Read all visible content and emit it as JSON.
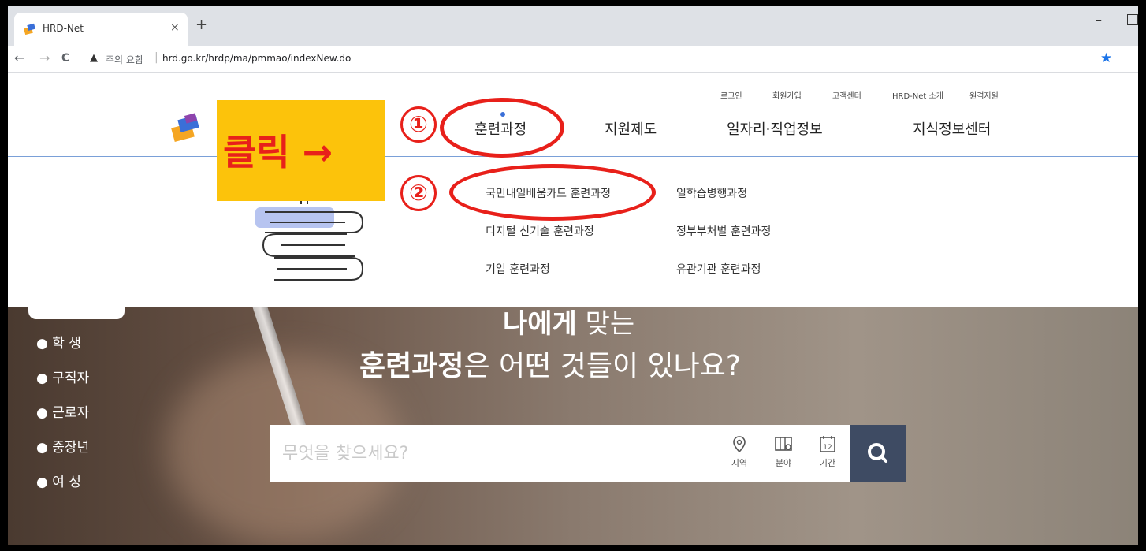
{
  "browser": {
    "tab_title": "HRD-Net",
    "tab_close": "×",
    "new_tab": "+",
    "min": "–",
    "warning": "주의 요함",
    "url": "hrd.go.kr/hrdp/ma/pmmao/indexNew.do",
    "back": "←",
    "forward": "→",
    "reload": "C"
  },
  "utility_links": [
    "로그인",
    "회원가입",
    "고객센터",
    "HRD-Net 소개",
    "원격지원"
  ],
  "gnb": [
    "훈련과정",
    "지원제도",
    "일자리·직업정보",
    "지식정보센터"
  ],
  "dropdown": {
    "col1": [
      "국민내일배움카드 훈련과정",
      "디지털 신기술 훈련과정",
      "기업 훈련과정"
    ],
    "col2": [
      "일학습병행과정",
      "정부부처별 훈련과정",
      "유관기관 훈련과정"
    ]
  },
  "hero": {
    "line1_bold": "나에게",
    "line1_rest": " 맞는",
    "line2_bold": "훈련과정",
    "line2_rest": "은 어떤 것들이 있나요?"
  },
  "personas": [
    "● 학  생",
    "● 구직자",
    "● 근로자",
    "● 중장년",
    "● 여  성"
  ],
  "search": {
    "placeholder": "무엇을 찾으세요?",
    "filters": [
      "지역",
      "분야",
      "기간"
    ],
    "calendar_day": "12"
  },
  "annotation": {
    "click_label": "클릭 →",
    "step1": "①",
    "step2": "②"
  },
  "colors": {
    "accent_red": "#e8201a",
    "annotation_yellow": "#fcc30b",
    "search_button": "#3e4b63"
  }
}
